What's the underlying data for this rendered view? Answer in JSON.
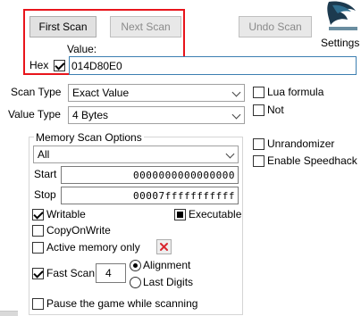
{
  "colors": {
    "highlight_box": "#e8141b",
    "red_x": "#d9262f",
    "input_border": "#7a7a7a"
  },
  "scan_buttons": {
    "first_scan": "First Scan",
    "next_scan": "Next Scan",
    "undo_scan": "Undo Scan"
  },
  "settings": {
    "label": "Settings",
    "icon": "cheat-engine-logo-icon"
  },
  "value": {
    "label": "Value:",
    "hex_label": "Hex",
    "hex_checked": true,
    "input": "014D80E0"
  },
  "scan_type": {
    "label": "Scan Type",
    "selected": "Exact Value"
  },
  "value_type": {
    "label": "Value Type",
    "selected": "4 Bytes"
  },
  "right_options": {
    "lua_formula": "Lua formula",
    "not": "Not",
    "unrandomizer": "Unrandomizer",
    "enable_speedhack": "Enable Speedhack"
  },
  "memory_scan_options": {
    "title": "Memory Scan Options",
    "region": "All",
    "start_label": "Start",
    "start_value": "0000000000000000",
    "stop_label": "Stop",
    "stop_value": "00007fffffffffff",
    "writable": "Writable",
    "executable": "Executable",
    "copy_on_write": "CopyOnWrite",
    "active_memory_only": "Active memory only",
    "fast_scan": "Fast Scan",
    "fast_scan_value": "4",
    "alignment": "Alignment",
    "last_digits": "Last Digits",
    "pause_game": "Pause the game while scanning"
  }
}
